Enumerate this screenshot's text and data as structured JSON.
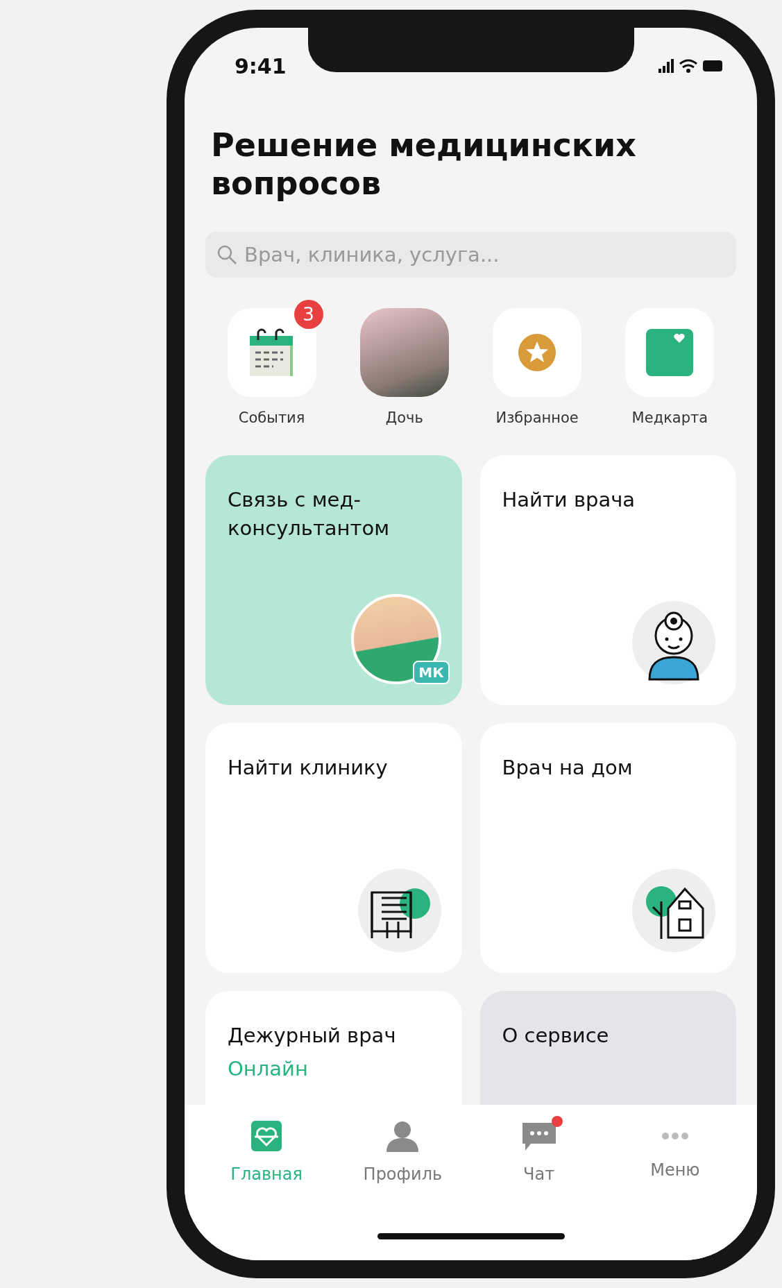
{
  "status_bar": {
    "time": "9:41"
  },
  "title": "Решение медицинских вопросов",
  "search": {
    "placeholder": "Врач, клиника, услуга..."
  },
  "shortcuts": [
    {
      "kind": "calendar",
      "label": "События",
      "badge": "3"
    },
    {
      "kind": "photo",
      "label": "Дочь"
    },
    {
      "kind": "star",
      "label": "Избранное"
    },
    {
      "kind": "medcard",
      "label": "Медкарта"
    }
  ],
  "cards": [
    {
      "kind": "consultant",
      "title": "Связь с мед-консультантом",
      "avatar_badge": "МК"
    },
    {
      "kind": "doctor",
      "title": "Найти врача"
    },
    {
      "kind": "clinic",
      "title": "Найти клинику"
    },
    {
      "kind": "house",
      "title": "Врач на дом"
    },
    {
      "kind": "duty",
      "title": "Дежурный врач",
      "subtitle": "Онлайн"
    },
    {
      "kind": "about",
      "title": "О сервисе"
    }
  ],
  "tab_bar": [
    {
      "kind": "home",
      "label": "Главная",
      "selected": true,
      "unread": false
    },
    {
      "kind": "profile",
      "label": "Профиль",
      "selected": false,
      "unread": false
    },
    {
      "kind": "chat",
      "label": "Чат",
      "selected": false,
      "unread": true
    },
    {
      "kind": "menu",
      "label": "Меню",
      "selected": false,
      "unread": false
    }
  ]
}
